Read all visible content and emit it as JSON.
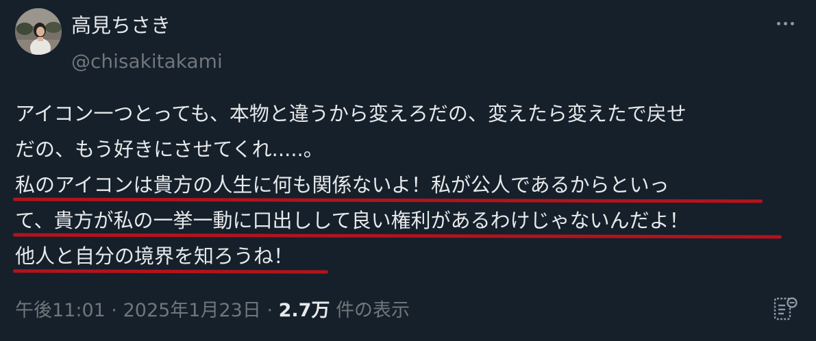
{
  "user": {
    "display_name": "高見ちさき",
    "handle": "@chisakitakami"
  },
  "tweet": {
    "lines": [
      "アイコン一つとっても、本物と違うから変えろだの、変えたら変えたで戻せ",
      "だの、もう好きにさせてくれ.....。",
      "私のアイコンは貴方の人生に何も関係ないよ！私が公人であるからといっ",
      "て、貴方が私の一挙一動に口出しして良い権利があるわけじゃないんだよ！",
      "他人と自分の境界を知ろうね！"
    ]
  },
  "meta": {
    "time": "午後11:01",
    "separator": "·",
    "date": "2025年1月23日",
    "views_count": "2.7万",
    "views_label": "件の表示"
  },
  "icons": {
    "more": "more-horizontal-icon",
    "analytics": "analytics-icon"
  },
  "colors": {
    "background": "#15202b",
    "text_primary": "#e7e9ea",
    "text_secondary": "#71767b",
    "underline_annotation": "#b3131c"
  }
}
